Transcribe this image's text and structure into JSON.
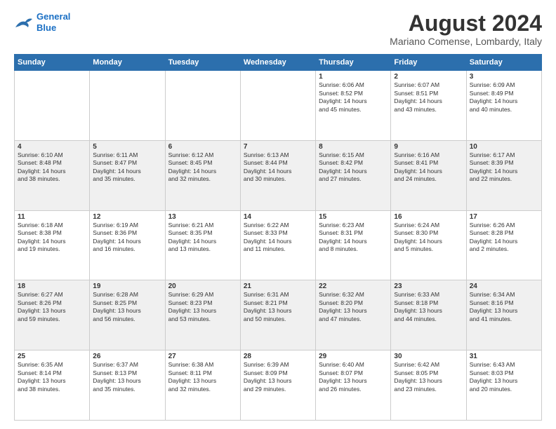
{
  "header": {
    "logo_line1": "General",
    "logo_line2": "Blue",
    "main_title": "August 2024",
    "subtitle": "Mariano Comense, Lombardy, Italy"
  },
  "weekdays": [
    "Sunday",
    "Monday",
    "Tuesday",
    "Wednesday",
    "Thursday",
    "Friday",
    "Saturday"
  ],
  "weeks": [
    [
      {
        "day": "",
        "info": ""
      },
      {
        "day": "",
        "info": ""
      },
      {
        "day": "",
        "info": ""
      },
      {
        "day": "",
        "info": ""
      },
      {
        "day": "1",
        "info": "Sunrise: 6:06 AM\nSunset: 8:52 PM\nDaylight: 14 hours\nand 45 minutes."
      },
      {
        "day": "2",
        "info": "Sunrise: 6:07 AM\nSunset: 8:51 PM\nDaylight: 14 hours\nand 43 minutes."
      },
      {
        "day": "3",
        "info": "Sunrise: 6:09 AM\nSunset: 8:49 PM\nDaylight: 14 hours\nand 40 minutes."
      }
    ],
    [
      {
        "day": "4",
        "info": "Sunrise: 6:10 AM\nSunset: 8:48 PM\nDaylight: 14 hours\nand 38 minutes."
      },
      {
        "day": "5",
        "info": "Sunrise: 6:11 AM\nSunset: 8:47 PM\nDaylight: 14 hours\nand 35 minutes."
      },
      {
        "day": "6",
        "info": "Sunrise: 6:12 AM\nSunset: 8:45 PM\nDaylight: 14 hours\nand 32 minutes."
      },
      {
        "day": "7",
        "info": "Sunrise: 6:13 AM\nSunset: 8:44 PM\nDaylight: 14 hours\nand 30 minutes."
      },
      {
        "day": "8",
        "info": "Sunrise: 6:15 AM\nSunset: 8:42 PM\nDaylight: 14 hours\nand 27 minutes."
      },
      {
        "day": "9",
        "info": "Sunrise: 6:16 AM\nSunset: 8:41 PM\nDaylight: 14 hours\nand 24 minutes."
      },
      {
        "day": "10",
        "info": "Sunrise: 6:17 AM\nSunset: 8:39 PM\nDaylight: 14 hours\nand 22 minutes."
      }
    ],
    [
      {
        "day": "11",
        "info": "Sunrise: 6:18 AM\nSunset: 8:38 PM\nDaylight: 14 hours\nand 19 minutes."
      },
      {
        "day": "12",
        "info": "Sunrise: 6:19 AM\nSunset: 8:36 PM\nDaylight: 14 hours\nand 16 minutes."
      },
      {
        "day": "13",
        "info": "Sunrise: 6:21 AM\nSunset: 8:35 PM\nDaylight: 14 hours\nand 13 minutes."
      },
      {
        "day": "14",
        "info": "Sunrise: 6:22 AM\nSunset: 8:33 PM\nDaylight: 14 hours\nand 11 minutes."
      },
      {
        "day": "15",
        "info": "Sunrise: 6:23 AM\nSunset: 8:31 PM\nDaylight: 14 hours\nand 8 minutes."
      },
      {
        "day": "16",
        "info": "Sunrise: 6:24 AM\nSunset: 8:30 PM\nDaylight: 14 hours\nand 5 minutes."
      },
      {
        "day": "17",
        "info": "Sunrise: 6:26 AM\nSunset: 8:28 PM\nDaylight: 14 hours\nand 2 minutes."
      }
    ],
    [
      {
        "day": "18",
        "info": "Sunrise: 6:27 AM\nSunset: 8:26 PM\nDaylight: 13 hours\nand 59 minutes."
      },
      {
        "day": "19",
        "info": "Sunrise: 6:28 AM\nSunset: 8:25 PM\nDaylight: 13 hours\nand 56 minutes."
      },
      {
        "day": "20",
        "info": "Sunrise: 6:29 AM\nSunset: 8:23 PM\nDaylight: 13 hours\nand 53 minutes."
      },
      {
        "day": "21",
        "info": "Sunrise: 6:31 AM\nSunset: 8:21 PM\nDaylight: 13 hours\nand 50 minutes."
      },
      {
        "day": "22",
        "info": "Sunrise: 6:32 AM\nSunset: 8:20 PM\nDaylight: 13 hours\nand 47 minutes."
      },
      {
        "day": "23",
        "info": "Sunrise: 6:33 AM\nSunset: 8:18 PM\nDaylight: 13 hours\nand 44 minutes."
      },
      {
        "day": "24",
        "info": "Sunrise: 6:34 AM\nSunset: 8:16 PM\nDaylight: 13 hours\nand 41 minutes."
      }
    ],
    [
      {
        "day": "25",
        "info": "Sunrise: 6:35 AM\nSunset: 8:14 PM\nDaylight: 13 hours\nand 38 minutes."
      },
      {
        "day": "26",
        "info": "Sunrise: 6:37 AM\nSunset: 8:13 PM\nDaylight: 13 hours\nand 35 minutes."
      },
      {
        "day": "27",
        "info": "Sunrise: 6:38 AM\nSunset: 8:11 PM\nDaylight: 13 hours\nand 32 minutes."
      },
      {
        "day": "28",
        "info": "Sunrise: 6:39 AM\nSunset: 8:09 PM\nDaylight: 13 hours\nand 29 minutes."
      },
      {
        "day": "29",
        "info": "Sunrise: 6:40 AM\nSunset: 8:07 PM\nDaylight: 13 hours\nand 26 minutes."
      },
      {
        "day": "30",
        "info": "Sunrise: 6:42 AM\nSunset: 8:05 PM\nDaylight: 13 hours\nand 23 minutes."
      },
      {
        "day": "31",
        "info": "Sunrise: 6:43 AM\nSunset: 8:03 PM\nDaylight: 13 hours\nand 20 minutes."
      }
    ]
  ]
}
